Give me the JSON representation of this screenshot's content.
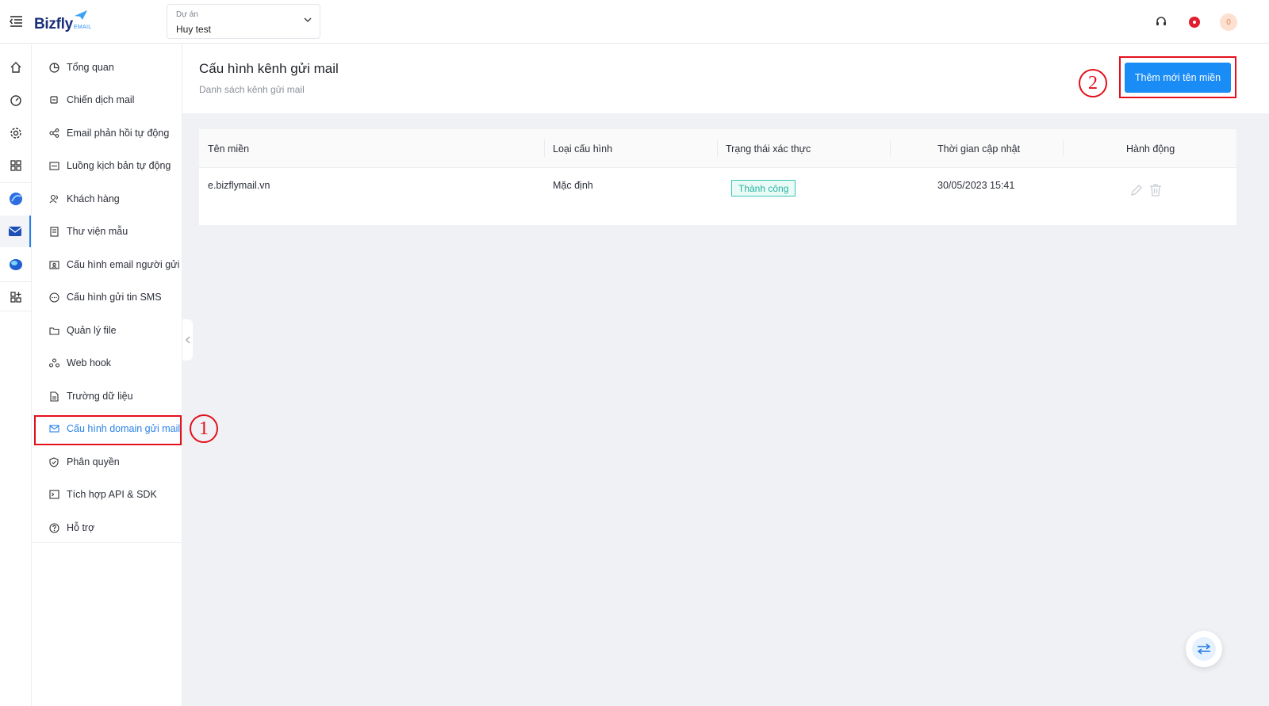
{
  "app": {
    "logo_text": "Bizfly",
    "logo_sub": "EMAIL"
  },
  "project": {
    "label": "Dự án",
    "value": "Huy test"
  },
  "header": {
    "avatar_count": "0"
  },
  "side_menu": {
    "items": [
      {
        "label": "Tổng quan"
      },
      {
        "label": "Chiến dịch mail"
      },
      {
        "label": "Email phản hồi tự động"
      },
      {
        "label": "Luồng kịch bản tự động"
      },
      {
        "label": "Khách hàng"
      },
      {
        "label": "Thư viện mẫu"
      },
      {
        "label": "Cấu hình email người gửi"
      },
      {
        "label": "Cấu hình gửi tin SMS"
      },
      {
        "label": "Quản lý file"
      },
      {
        "label": "Web hook"
      },
      {
        "label": "Trường dữ liệu"
      },
      {
        "label": "Cấu hình domain gửi mail",
        "active": true
      },
      {
        "label": "Phân quyền"
      },
      {
        "label": "Tích hợp API & SDK"
      },
      {
        "label": "Hỗ trợ"
      }
    ]
  },
  "page": {
    "title": "Cấu hình kênh gửi mail",
    "subtitle": "Danh sách kênh gửi mail",
    "add_button": "Thêm mới tên miền"
  },
  "table": {
    "columns": [
      "Tên miền",
      "Loại cấu hình",
      "Trạng thái xác thực",
      "Thời gian cập nhật",
      "Hành động"
    ],
    "rows": [
      {
        "domain": "e.bizflymail.vn",
        "type": "Mặc định",
        "status": "Thành công",
        "updated": "30/05/2023 15:41"
      }
    ]
  },
  "annotations": {
    "step1": "1",
    "step2": "2"
  },
  "colors": {
    "accent": "#1a8cf5",
    "brand": "#1a2f7a",
    "highlight": "#e3101c",
    "success": "#26b3a1"
  }
}
